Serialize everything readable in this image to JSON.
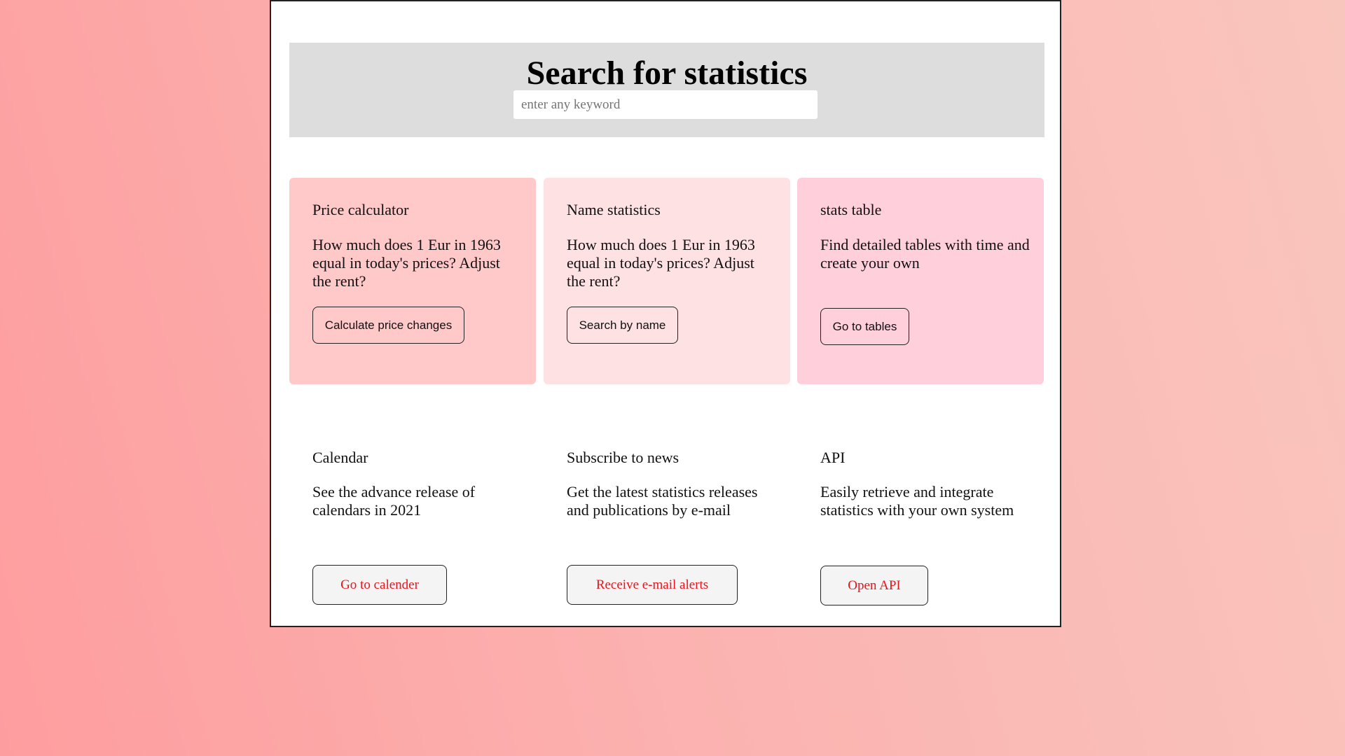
{
  "search": {
    "title": "Search for statistics",
    "placeholder": "enter any keyword",
    "value": ""
  },
  "cards": [
    {
      "title": "Price calculator",
      "text": "How much does 1 Eur in 1963 equal in today's prices? Adjust the rent?",
      "button": "Calculate price changes",
      "color": "#ffc8c9"
    },
    {
      "title": "Name statistics",
      "text": "How much does 1 Eur in 1963 equal in today's prices? Adjust the rent?",
      "button": "Search by name",
      "color": "#fde1e3"
    },
    {
      "title": "stats table",
      "text": "Find detailed tables with time and create your own",
      "button": "Go to tables",
      "color": "#ffcfdc"
    }
  ],
  "features": [
    {
      "title": "Calendar",
      "text": "See the advance release of calendars in 2021",
      "button": "Go to calender"
    },
    {
      "title": "Subscribe to news",
      "text": "Get the latest statistics releases and publications by e-mail",
      "button": "Receive e-mail alerts"
    },
    {
      "title": "API",
      "text": "Easily retrieve and integrate statistics with your own system",
      "button": "Open API"
    }
  ],
  "colors": {
    "banner": "#dddddd",
    "link_button_text": "#e8141c",
    "background_start": "#fe9d9f",
    "background_end": "#f9c6bd"
  }
}
